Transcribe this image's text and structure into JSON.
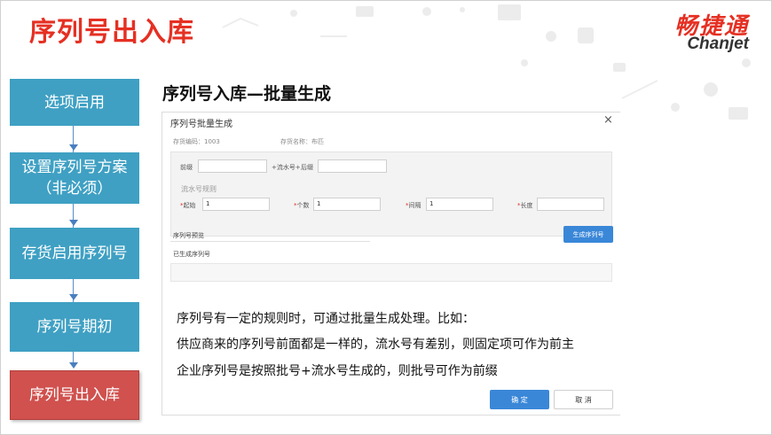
{
  "slide": {
    "title": "序列号出入库",
    "subtitle": "序列号入库—批量生成"
  },
  "brand": {
    "name_cn": "畅捷通",
    "name_en": "Chanjet",
    "color": "#e53023"
  },
  "steps": [
    {
      "label": "选项启用"
    },
    {
      "label": "设置序列号方案（非必须）"
    },
    {
      "label": "存货启用序列号"
    },
    {
      "label": "序列号期初"
    },
    {
      "label": "序列号出入库",
      "active": true
    }
  ],
  "dialog": {
    "title": "序列号批量生成",
    "close_icon": "×",
    "inventory_code": "存货编码：1003",
    "inventory_name": "存货名称：布匹",
    "prefix_label": "前缀",
    "prefix_value": "",
    "serial_label": "+流水号+",
    "suffix_label": "后缀",
    "suffix_value": "",
    "rule_section": "流水号规则",
    "start_label": "起始",
    "start_value": "1",
    "count_label": "个数",
    "count_value": "1",
    "interval_label": "间隔",
    "interval_value": "1",
    "length_label": "长度",
    "length_value": "",
    "preview_label": "序列号预览",
    "generate_button": "生成序列号",
    "generated_label": "已生成序列号",
    "ok_button": "确 定",
    "cancel_button": "取 消"
  },
  "notes": [
    "序列号有一定的规则时，可通过批量生成处理。比如：",
    "供应商来的序列号前面都是一样的，流水号有差别，则固定项可作为前主",
    "企业序列号是按照批号+流水号生成的，则批号可作为前缀"
  ],
  "colors": {
    "accent_red": "#e53023",
    "step_blue": "#3fa0c3",
    "step_active": "#d0514e",
    "button_blue": "#3a87d8"
  }
}
